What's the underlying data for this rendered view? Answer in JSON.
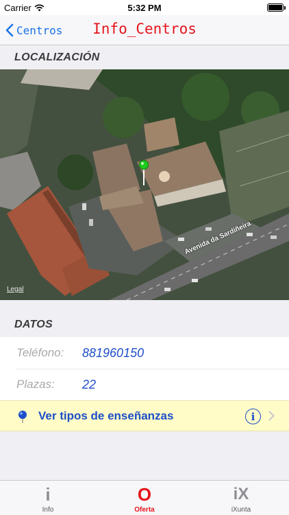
{
  "status_bar": {
    "carrier": "Carrier",
    "time": "5:32 PM"
  },
  "nav": {
    "back_label": "Centros",
    "title": "Info_Centros"
  },
  "sections": {
    "location_header": "LOCALIZACIÓN",
    "data_header": "DATOS"
  },
  "map": {
    "street_label": "Avenida da Sardiñeira",
    "legal_label": "Legal"
  },
  "datos": {
    "rows": [
      {
        "label": "Teléfono:",
        "value": "881960150"
      },
      {
        "label": "Plazas:",
        "value": "22"
      }
    ]
  },
  "action_row": {
    "label": "Ver tipos de enseñanzas"
  },
  "tabs": [
    {
      "label": "Info",
      "icon": "i"
    },
    {
      "label": "Oferta",
      "icon": "O"
    },
    {
      "label": "iXunta",
      "icon": "iX"
    }
  ],
  "colors": {
    "accent_red": "#e5141b",
    "link_blue": "#1d4fc8",
    "back_blue": "#1a73e8",
    "highlight_yellow": "#fffcc8"
  }
}
